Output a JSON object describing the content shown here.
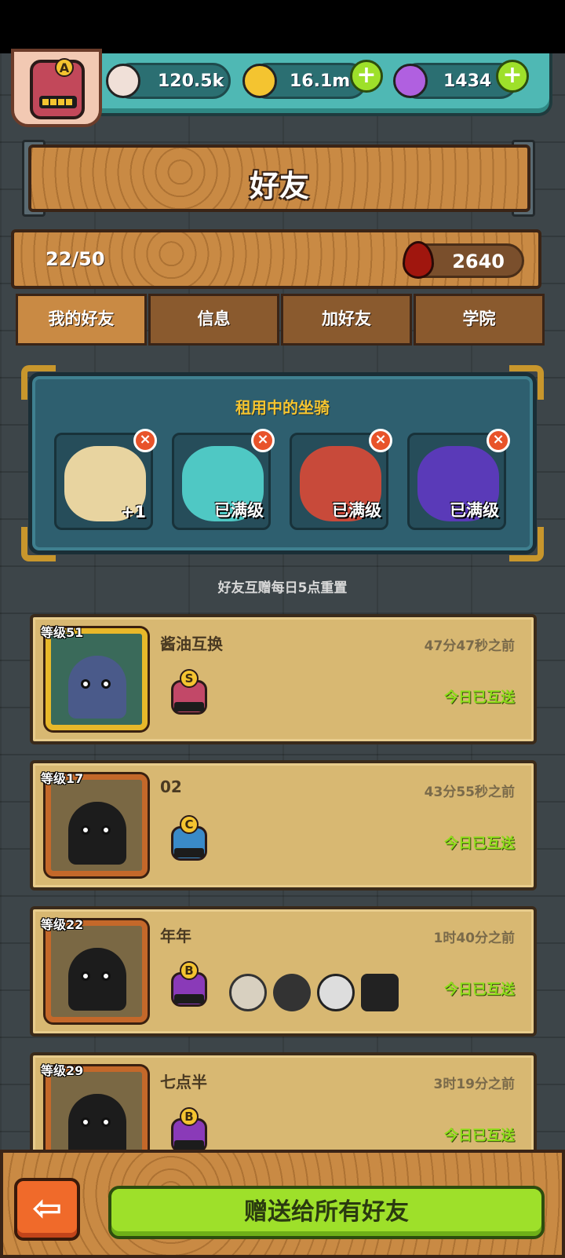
{
  "resources": {
    "eyeballs": "120.5k",
    "coins": "16.1m",
    "potions": "1434",
    "plus": "+"
  },
  "profile": {
    "rank": "A"
  },
  "header": {
    "title": "好友"
  },
  "friend_count": "22/50",
  "blood": "2640",
  "tabs": [
    {
      "label": "我的好友"
    },
    {
      "label": "信息"
    },
    {
      "label": "加好友"
    },
    {
      "label": "学院"
    }
  ],
  "rented_mounts": {
    "title": "租用中的坐骑",
    "close": "×",
    "slots": [
      {
        "label": "+1",
        "color": "#e8d4a0"
      },
      {
        "label": "已满级",
        "color": "#4fc8c4"
      },
      {
        "label": "已满级",
        "color": "#c84a3a"
      },
      {
        "label": "已满级",
        "color": "#5a3ab8"
      }
    ]
  },
  "reset_note": "好友互赠每日5点重置",
  "friends": [
    {
      "level": "等级51",
      "name": "酱油互换",
      "time": "47分47秒之前",
      "status": "今日已互送",
      "rank": "S",
      "rank_color": "#c24868"
    },
    {
      "level": "等级17",
      "name": "02",
      "time": "43分55秒之前",
      "status": "今日已互送",
      "rank": "C",
      "rank_color": "#3a8ac8"
    },
    {
      "level": "等级22",
      "name": "年年",
      "time": "1时40分之前",
      "status": "今日已互送",
      "rank": "B",
      "rank_color": "#8a3ab8"
    },
    {
      "level": "等级29",
      "name": "七点半",
      "time": "3时19分之前",
      "status": "今日已互送",
      "rank": "B",
      "rank_color": "#8a3ab8"
    }
  ],
  "bottom": {
    "back": "⇦",
    "gift_all": "赠送给所有好友"
  }
}
